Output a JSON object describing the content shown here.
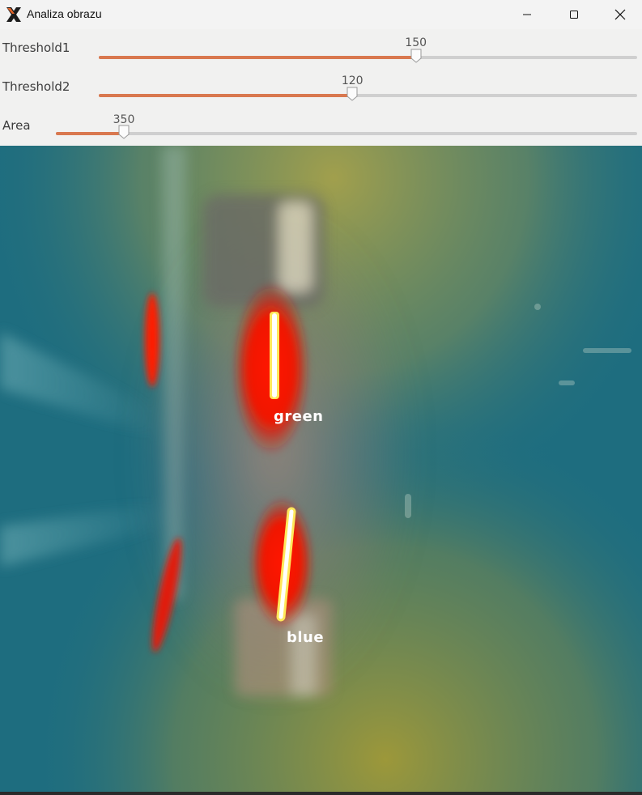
{
  "window": {
    "title": "Analiza obrazu",
    "icon": "x-app-icon"
  },
  "trackbars": [
    {
      "label": "Threshold1",
      "value": "150",
      "fraction": 0.589
    },
    {
      "label": "Threshold2",
      "value": "120",
      "fraction": 0.471
    },
    {
      "label": "Area",
      "value": "350",
      "fraction": 0.117
    }
  ],
  "detections": [
    {
      "label": "green"
    },
    {
      "label": "blue"
    }
  ],
  "colors": {
    "accent": "#d9784f",
    "groove": "#cfcfcf",
    "water": "#1f6f82",
    "highlight": "#ff1a00"
  }
}
